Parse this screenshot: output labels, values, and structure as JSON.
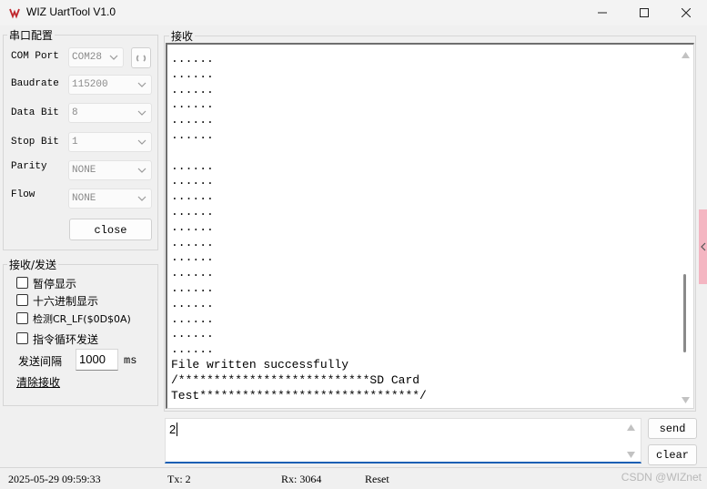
{
  "window": {
    "title": "WIZ UartTool V1.0"
  },
  "serial": {
    "group_title": "串口配置",
    "com_port_label": "COM Port",
    "com_port_value": "COM28",
    "baudrate_label": "Baudrate",
    "baudrate_value": "115200",
    "databit_label": "Data Bit",
    "databit_value": "8",
    "stopbit_label": "Stop Bit",
    "stopbit_value": "1",
    "parity_label": "Parity",
    "parity_value": "NONE",
    "flow_label": "Flow",
    "flow_value": "NONE",
    "close_label": "close"
  },
  "txrx": {
    "group_title": "接收/发送",
    "pause_display": "暂停显示",
    "hex_display": "十六进制显示",
    "detect_crlf": "检测CR_LF($0D$0A)",
    "loop_send": "指令循环发送",
    "interval_label": "发送间隔",
    "interval_value": "1000",
    "interval_unit": "ms",
    "clear_recv": "清除接收"
  },
  "receive": {
    "group_title": "接收",
    "lines": [
      "......",
      "......",
      "......",
      "......",
      "......",
      "......",
      "",
      "......",
      "......",
      "......",
      "......",
      "......",
      "......",
      "......",
      "......",
      "......",
      "......",
      "......",
      "......",
      "......",
      "File written successfully",
      "/***************************SD Card",
      "Test*******************************/"
    ]
  },
  "send": {
    "value": "2",
    "send_label": "send",
    "clear_label": "clear"
  },
  "status": {
    "datetime": "2025-05-29 09:59:33",
    "tx": "Tx: 2",
    "rx": "Rx: 3064",
    "reset": "Reset",
    "watermark": "CSDN @WIZnet"
  }
}
